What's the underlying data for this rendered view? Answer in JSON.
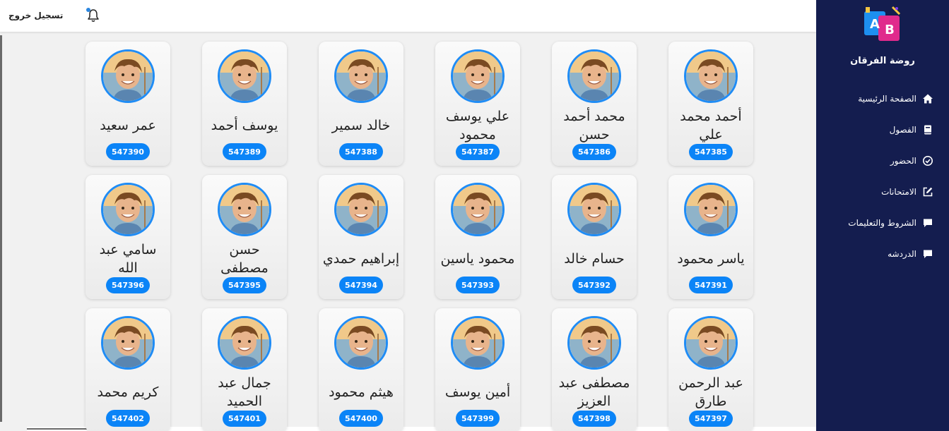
{
  "topbar": {
    "logout_label": "تسجيل خروج"
  },
  "sidebar": {
    "school_name": "روضة الفرقان",
    "items": [
      {
        "label": "الصفحة الرئيسية",
        "icon": "home-icon"
      },
      {
        "label": "الفصول",
        "icon": "book-icon"
      },
      {
        "label": "الحضور",
        "icon": "check-circle-icon"
      },
      {
        "label": "الامتحانات",
        "icon": "edit-icon"
      },
      {
        "label": "الشروط والتعليمات",
        "icon": "comment-icon"
      },
      {
        "label": "الدردشه",
        "icon": "chat-icon"
      }
    ]
  },
  "students": [
    {
      "name": "أحمد محمد علي",
      "code": "547385"
    },
    {
      "name": "محمد أحمد حسن",
      "code": "547386"
    },
    {
      "name": "علي يوسف محمود",
      "code": "547387"
    },
    {
      "name": "خالد سمير",
      "code": "547388"
    },
    {
      "name": "يوسف أحمد",
      "code": "547389"
    },
    {
      "name": "عمر سعيد",
      "code": "547390"
    },
    {
      "name": "ياسر محمود",
      "code": "547391"
    },
    {
      "name": "حسام خالد",
      "code": "547392"
    },
    {
      "name": "محمود ياسين",
      "code": "547393"
    },
    {
      "name": "إبراهيم حمدي",
      "code": "547394"
    },
    {
      "name": "حسن مصطفى",
      "code": "547395"
    },
    {
      "name": "سامي عبد الله",
      "code": "547396"
    },
    {
      "name": "عبد الرحمن طارق",
      "code": "547397"
    },
    {
      "name": "مصطفى عبد العزيز",
      "code": "547398"
    },
    {
      "name": "أمين يوسف",
      "code": "547399"
    },
    {
      "name": "هيثم محمود",
      "code": "547400"
    },
    {
      "name": "جمال عبد الحميد",
      "code": "547401"
    },
    {
      "name": "كريم محمد",
      "code": "547402"
    }
  ]
}
